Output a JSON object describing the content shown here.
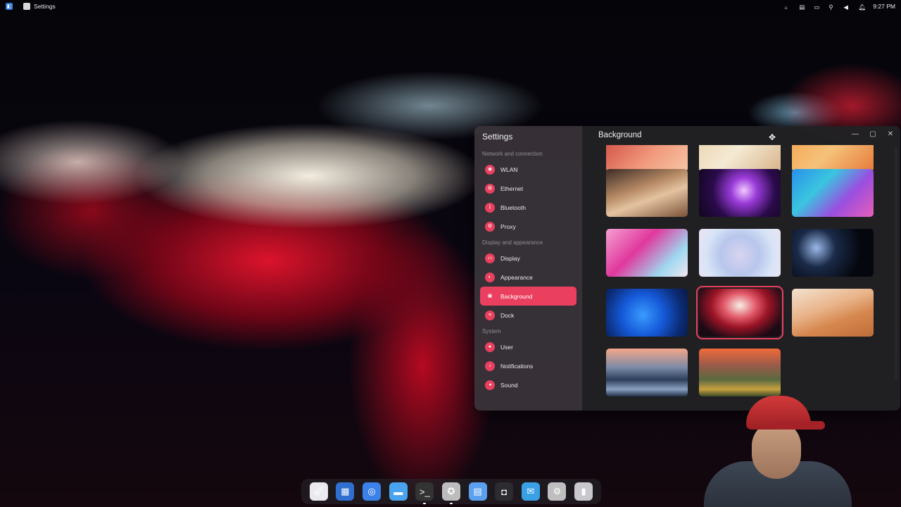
{
  "topbar": {
    "app_name": "Settings",
    "clock": "9:27 PM"
  },
  "settings": {
    "sidebar_title": "Settings",
    "groups": [
      {
        "label": "Network and connection",
        "items": [
          {
            "label": "WLAN",
            "icon": "wifi-icon"
          },
          {
            "label": "Ethernet",
            "icon": "ethernet-icon"
          },
          {
            "label": "Bluetooth",
            "icon": "bluetooth-icon"
          },
          {
            "label": "Proxy",
            "icon": "proxy-icon"
          }
        ]
      },
      {
        "label": "Display and appearance",
        "items": [
          {
            "label": "Display",
            "icon": "display-icon"
          },
          {
            "label": "Appearance",
            "icon": "palette-icon"
          },
          {
            "label": "Background",
            "icon": "image-icon",
            "active": true
          },
          {
            "label": "Dock",
            "icon": "dock-icon"
          }
        ]
      },
      {
        "label": "System",
        "items": [
          {
            "label": "User",
            "icon": "user-icon"
          },
          {
            "label": "Notifications",
            "icon": "bell-icon"
          },
          {
            "label": "Sound",
            "icon": "speaker-icon"
          }
        ]
      }
    ],
    "content_title": "Background",
    "selected_wallpaper_index": 10,
    "accent_color": "#ea3f5e"
  },
  "dock": {
    "items": [
      "launcher-icon",
      "multitask-view-icon",
      "browser-icon",
      "file-manager-icon",
      "terminal-icon",
      "app-store-icon",
      "calendar-icon",
      "screenshot-icon",
      "mail-icon",
      "settings-icon",
      "trash-icon"
    ]
  }
}
